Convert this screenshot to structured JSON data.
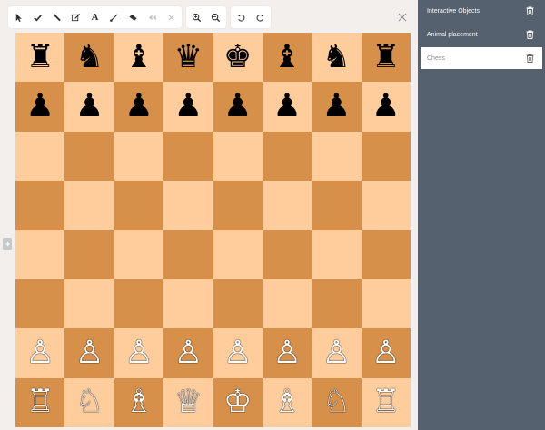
{
  "toolbar": {
    "groups": [
      [
        "select-tool",
        "check-tool",
        "pen-tool",
        "note-tool",
        "text-tool",
        "brush-tool",
        "eraser-tool",
        "prev-tool",
        "clear-tool"
      ],
      [
        "zoom-in",
        "zoom-out"
      ],
      [
        "undo",
        "redo"
      ]
    ],
    "text_tool_glyph": "A"
  },
  "board": {
    "ranks": [
      [
        "♜",
        "♞",
        "♝",
        "♛",
        "♚",
        "♝",
        "♞",
        "♜"
      ],
      [
        "♟",
        "♟",
        "♟",
        "♟",
        "♟",
        "♟",
        "♟",
        "♟"
      ],
      [
        "",
        "",
        "",
        "",
        "",
        "",
        "",
        ""
      ],
      [
        "",
        "",
        "",
        "",
        "",
        "",
        "",
        ""
      ],
      [
        "",
        "",
        "",
        "",
        "",
        "",
        "",
        ""
      ],
      [
        "",
        "",
        "",
        "",
        "",
        "",
        "",
        ""
      ],
      [
        "♙",
        "♙",
        "♙",
        "♙",
        "♙",
        "♙",
        "♙",
        "♙"
      ],
      [
        "♖",
        "♘",
        "♗",
        "♕",
        "♔",
        "♗",
        "♘",
        "♖"
      ]
    ],
    "light_color": "#ffcc9c",
    "dark_color": "#d6904a"
  },
  "sidebar": {
    "background": "#55616e",
    "items": [
      {
        "label": "Interactive Objects",
        "active": false
      },
      {
        "label": "Animal placement",
        "active": false
      },
      {
        "label": "Chess",
        "active": true
      }
    ]
  }
}
